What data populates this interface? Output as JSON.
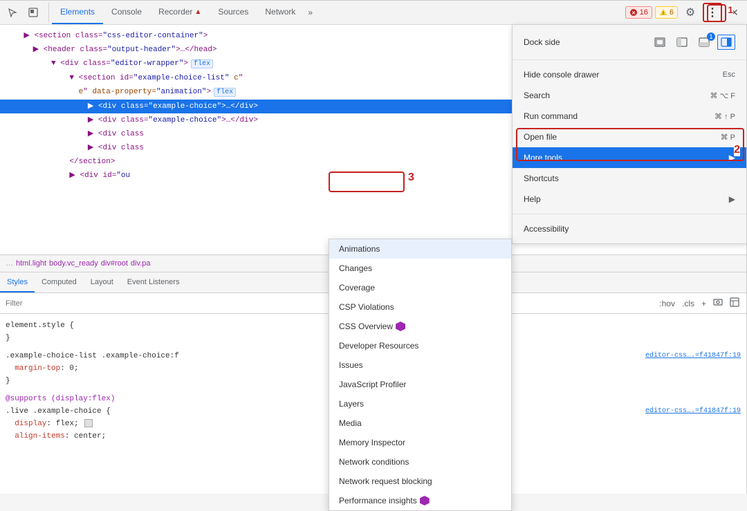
{
  "toolbar": {
    "tabs": [
      {
        "label": "Elements",
        "active": true
      },
      {
        "label": "Console",
        "active": false
      },
      {
        "label": "Recorder",
        "active": false
      },
      {
        "label": "Sources",
        "active": false
      },
      {
        "label": "Network",
        "active": false
      }
    ],
    "overflow_label": "»",
    "error_count": "16",
    "warning_count": "6",
    "settings_label": "⚙",
    "more_label": "⋮",
    "close_label": "✕"
  },
  "elements": {
    "lines": [
      {
        "indent": 0,
        "content": "▶ <section class=\"css-editor-container\">",
        "selected": false
      },
      {
        "indent": 1,
        "content": "▶ <header class=\"output-header\">…</head>",
        "selected": false
      },
      {
        "indent": 2,
        "content": "▼ <div class=\"editor-wrapper\">",
        "flex": true,
        "selected": false
      },
      {
        "indent": 3,
        "content": "▼ <section id=\"example-choice-list\" c\"",
        "selected": false
      },
      {
        "indent": 4,
        "content": "e\" data-property=\"animation\">",
        "flex": true,
        "selected": false
      },
      {
        "indent": 4,
        "content": "▶ <div class=\"example-choice\">…</div>",
        "selected": true
      },
      {
        "indent": 4,
        "content": "▶ <div class=\"example-choice\">…</div>",
        "selected": false
      },
      {
        "indent": 4,
        "content": "▶ <div class",
        "selected": false
      },
      {
        "indent": 4,
        "content": "▶ <div class",
        "selected": false
      },
      {
        "indent": 3,
        "content": "</section>",
        "selected": false
      },
      {
        "indent": 3,
        "content": "▶ <div id=\"ou",
        "selected": false
      }
    ]
  },
  "breadcrumb": {
    "items": [
      "…",
      "html.light",
      "body.vc_ready",
      "div#root",
      "div.pa"
    ]
  },
  "styles": {
    "tabs": [
      {
        "label": "Styles",
        "active": true
      },
      {
        "label": "Computed",
        "active": false
      },
      {
        "label": "Layout",
        "active": false
      },
      {
        "label": "Event Listeners",
        "active": false
      }
    ],
    "filter_placeholder": "Filter",
    "toolbar_buttons": [
      ":hov",
      ".cls",
      "+"
    ],
    "rules": [
      {
        "selector": "element.style {",
        "properties": [],
        "close": "}"
      },
      {
        "selector": ".example-choice-list .example-choice:f",
        "properties": [
          {
            "prop": "margin-top",
            "value": "0;",
            "color": "red"
          }
        ],
        "close": "}",
        "source": ""
      },
      {
        "type": "supports",
        "selector": "@supports (display:flex)",
        "sub": ".live .example-choice {",
        "properties": [
          {
            "prop": "display",
            "value": "flex;",
            "color": "red"
          },
          {
            "prop": "align-items",
            "value": "center;",
            "color": "red"
          }
        ]
      }
    ],
    "source1": "editor-css….=f41847f:19",
    "source2": "editor-css….=f41847f:19"
  },
  "devtools_menu": {
    "dock_side_label": "Dock side",
    "dock_icons": [
      {
        "icon": "▣",
        "label": "undock"
      },
      {
        "icon": "◧",
        "label": "dock-left"
      },
      {
        "icon": "▭",
        "label": "dock-bottom",
        "badge": "1"
      },
      {
        "icon": "◨",
        "label": "dock-right",
        "active": true
      }
    ],
    "items": [
      {
        "label": "Hide console drawer",
        "shortcut": "Esc",
        "has_arrow": false
      },
      {
        "label": "Search",
        "shortcut": "⌘ ⌥ F",
        "has_arrow": false
      },
      {
        "label": "Run command",
        "shortcut": "⌘ ↑ P",
        "has_arrow": false
      },
      {
        "label": "Open file",
        "shortcut": "⌘ P",
        "has_arrow": false
      },
      {
        "label": "More tools",
        "shortcut": "",
        "has_arrow": true,
        "highlighted": true
      },
      {
        "label": "Shortcuts",
        "shortcut": "",
        "has_arrow": false
      },
      {
        "label": "Help",
        "shortcut": "",
        "has_arrow": true
      },
      {
        "label": "Accessibility",
        "shortcut": "",
        "has_arrow": false
      }
    ]
  },
  "more_tools_submenu": {
    "items": [
      {
        "label": "Animations",
        "active": true,
        "experiment": false
      },
      {
        "label": "Changes",
        "active": false,
        "experiment": false
      },
      {
        "label": "Coverage",
        "active": false,
        "experiment": false
      },
      {
        "label": "CSP Violations",
        "active": false,
        "experiment": false
      },
      {
        "label": "CSS Overview",
        "active": false,
        "experiment": true
      },
      {
        "label": "Developer Resources",
        "active": false,
        "experiment": false
      },
      {
        "label": "Issues",
        "active": false,
        "experiment": false
      },
      {
        "label": "JavaScript Profiler",
        "active": false,
        "experiment": false
      },
      {
        "label": "Layers",
        "active": false,
        "experiment": false
      },
      {
        "label": "Media",
        "active": false,
        "experiment": false
      },
      {
        "label": "Memory Inspector",
        "active": false,
        "experiment": false
      },
      {
        "label": "Network conditions",
        "active": false,
        "experiment": false
      },
      {
        "label": "Network request blocking",
        "active": false,
        "experiment": false
      },
      {
        "label": "Performance insights",
        "active": false,
        "experiment": true
      }
    ]
  },
  "annotations": {
    "number1": "1",
    "number2": "2",
    "number3": "3"
  }
}
